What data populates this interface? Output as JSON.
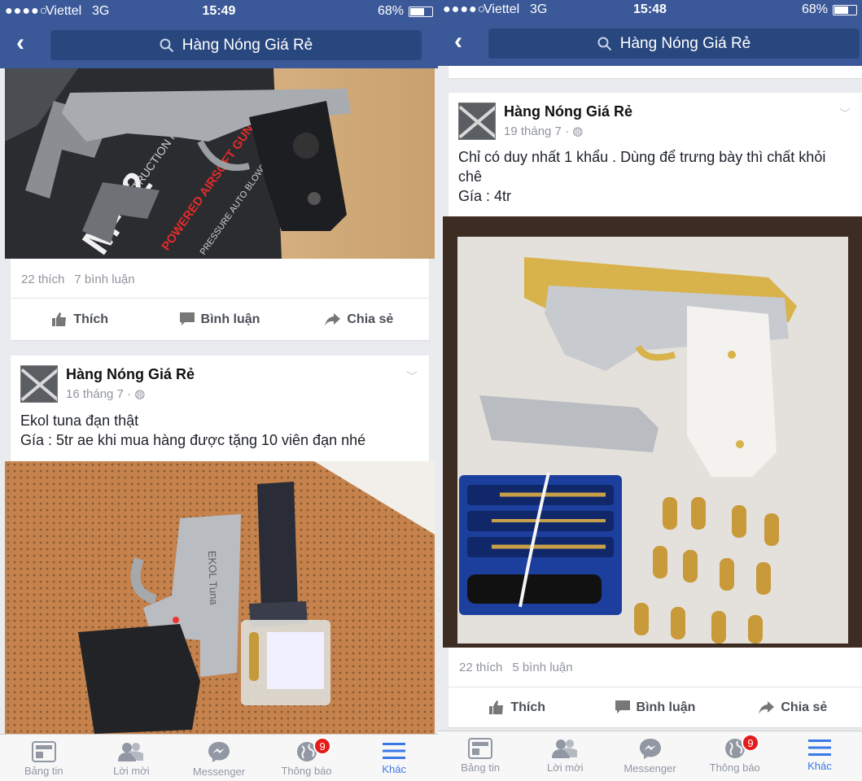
{
  "left": {
    "status": {
      "signal": "●●●●○",
      "carrier": "Viettel",
      "network": "3G",
      "time": "15:49",
      "battery": "68%"
    },
    "search_text": "Hàng Nóng Giá Rẻ",
    "post1": {
      "likes": "22 thích",
      "comments": "7 bình luận"
    },
    "post2": {
      "page_name": "Hàng Nóng Giá Rẻ",
      "date": "16 tháng 7 ·",
      "line1": "Ekol tuna đạn thật",
      "line2": "Gía : 5tr ae khi mua hàng được tặng 10 viên đạn nhé"
    }
  },
  "right": {
    "status": {
      "signal": "●●●●○",
      "carrier": "Viettel",
      "network": "3G",
      "time": "15:48",
      "battery": "68%"
    },
    "search_text": "Hàng Nóng Giá Rẻ",
    "post": {
      "page_name": "Hàng Nóng Giá Rẻ",
      "date": "19 tháng 7 ·",
      "line1": "Chỉ có duy nhất 1 khẩu . Dùng để trưng bày thì chất khỏi",
      "line2": "chê",
      "line3": "Gía : 4tr",
      "likes": "22 thích",
      "comments": "5 bình luận"
    }
  },
  "actions": {
    "like": "Thích",
    "comment": "Bình luận",
    "share": "Chia sẻ"
  },
  "photo_text": {
    "box_model": "M-92",
    "box_manual": "INSTRUCTION MANUAL",
    "box_airsoft": "POWERED AIRSOFT GUN",
    "box_blowback": "PRESSURE AUTO BLOWBACK",
    "gun_engraving": "EKOL Tuna"
  },
  "tabs": [
    {
      "label": "Bảng tin",
      "icon": "news-feed-icon"
    },
    {
      "label": "Lời mời",
      "icon": "friend-requests-icon"
    },
    {
      "label": "Messenger",
      "icon": "messenger-icon"
    },
    {
      "label": "Thông báo",
      "icon": "globe-icon",
      "badge": "9"
    },
    {
      "label": "Khác",
      "icon": "menu-icon"
    }
  ],
  "colors": {
    "brand": "#3b5998",
    "active_tab": "#3b78e7",
    "badge": "#e41b1b"
  }
}
